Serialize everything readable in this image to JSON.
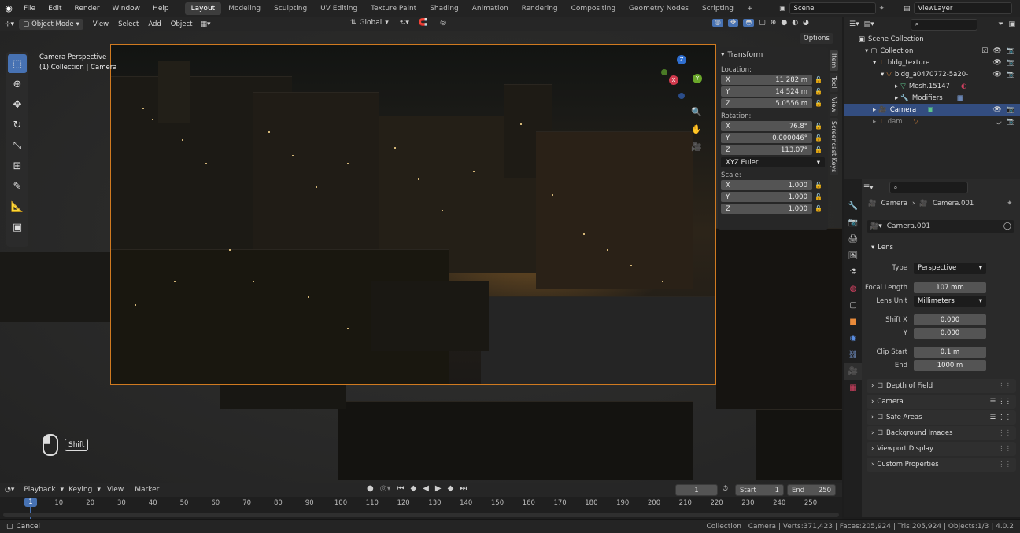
{
  "menu": {
    "items": [
      "File",
      "Edit",
      "Render",
      "Window",
      "Help"
    ]
  },
  "workspaces": [
    {
      "label": "Layout",
      "active": true
    },
    {
      "label": "Modeling"
    },
    {
      "label": "Sculpting"
    },
    {
      "label": "UV Editing"
    },
    {
      "label": "Texture Paint"
    },
    {
      "label": "Shading"
    },
    {
      "label": "Animation"
    },
    {
      "label": "Rendering"
    },
    {
      "label": "Compositing"
    },
    {
      "label": "Geometry Nodes"
    },
    {
      "label": "Scripting"
    }
  ],
  "scene": {
    "name": "Scene",
    "view_layer": "ViewLayer"
  },
  "viewport_header": {
    "mode": "Object Mode",
    "menus": [
      "View",
      "Select",
      "Add",
      "Object"
    ],
    "transform_orientation": "Global",
    "options_label": "Options"
  },
  "viewport": {
    "title": "Camera Perspective",
    "subtitle": "(1) Collection | Camera",
    "shift_key": "Shift"
  },
  "npanel": {
    "header": "Transform",
    "location_label": "Location:",
    "location": [
      {
        "axis": "X",
        "value": "11.282 m"
      },
      {
        "axis": "Y",
        "value": "14.524 m"
      },
      {
        "axis": "Z",
        "value": "5.0556 m"
      }
    ],
    "rotation_label": "Rotation:",
    "rotation": [
      {
        "axis": "X",
        "value": "76.8°"
      },
      {
        "axis": "Y",
        "value": "0.000046°"
      },
      {
        "axis": "Z",
        "value": "113.07°"
      }
    ],
    "rotation_mode": "XYZ Euler",
    "scale_label": "Scale:",
    "scale": [
      {
        "axis": "X",
        "value": "1.000"
      },
      {
        "axis": "Y",
        "value": "1.000"
      },
      {
        "axis": "Z",
        "value": "1.000"
      }
    ],
    "tabs": [
      "Item",
      "Tool",
      "View",
      "Screencast Keys"
    ]
  },
  "outliner": {
    "items": [
      {
        "label": "Scene Collection",
        "indent": 0
      },
      {
        "label": "Collection",
        "indent": 1
      },
      {
        "label": "bldg_texture",
        "indent": 2
      },
      {
        "label": "bldg_a0470772-5a20-",
        "indent": 3
      },
      {
        "label": "Mesh.15147",
        "indent": 4
      },
      {
        "label": "Modifiers",
        "indent": 4
      },
      {
        "label": "Camera",
        "indent": 2,
        "selected": true
      },
      {
        "label": "dam",
        "indent": 2
      }
    ]
  },
  "properties": {
    "breadcrumb": [
      "Camera",
      "Camera.001"
    ],
    "datablock": "Camera.001",
    "lens_panel": "Lens",
    "type_label": "Type",
    "type_value": "Perspective",
    "focal_label": "Focal Length",
    "focal_value": "107 mm",
    "unit_label": "Lens Unit",
    "unit_value": "Millimeters",
    "shiftx_label": "Shift X",
    "shiftx_value": "0.000",
    "shifty_label": "Y",
    "shifty_value": "0.000",
    "clipstart_label": "Clip Start",
    "clipstart_value": "0.1 m",
    "clipend_label": "End",
    "clipend_value": "1000 m",
    "panels": [
      "Depth of Field",
      "Camera",
      "Safe Areas",
      "Background Images",
      "Viewport Display",
      "Custom Properties"
    ]
  },
  "timeline": {
    "menus": [
      "Playback",
      "Keying",
      "View",
      "Marker"
    ],
    "current_frame": "1",
    "start_label": "Start",
    "start": "1",
    "end_label": "End",
    "end": "250",
    "ticks": [
      "1",
      "10",
      "20",
      "30",
      "40",
      "50",
      "60",
      "70",
      "80",
      "90",
      "100",
      "110",
      "120",
      "130",
      "140",
      "150",
      "160",
      "170",
      "180",
      "190",
      "200",
      "210",
      "220",
      "230",
      "240",
      "250"
    ]
  },
  "status": {
    "left": "Cancel",
    "right": "Collection | Camera | Verts:371,423 | Faces:205,924 | Tris:205,924 | Objects:1/3 | 4.0.2"
  },
  "colors": {
    "accent": "#4772b3",
    "camera_frame": "#d07a20",
    "selection": "#334d80"
  }
}
